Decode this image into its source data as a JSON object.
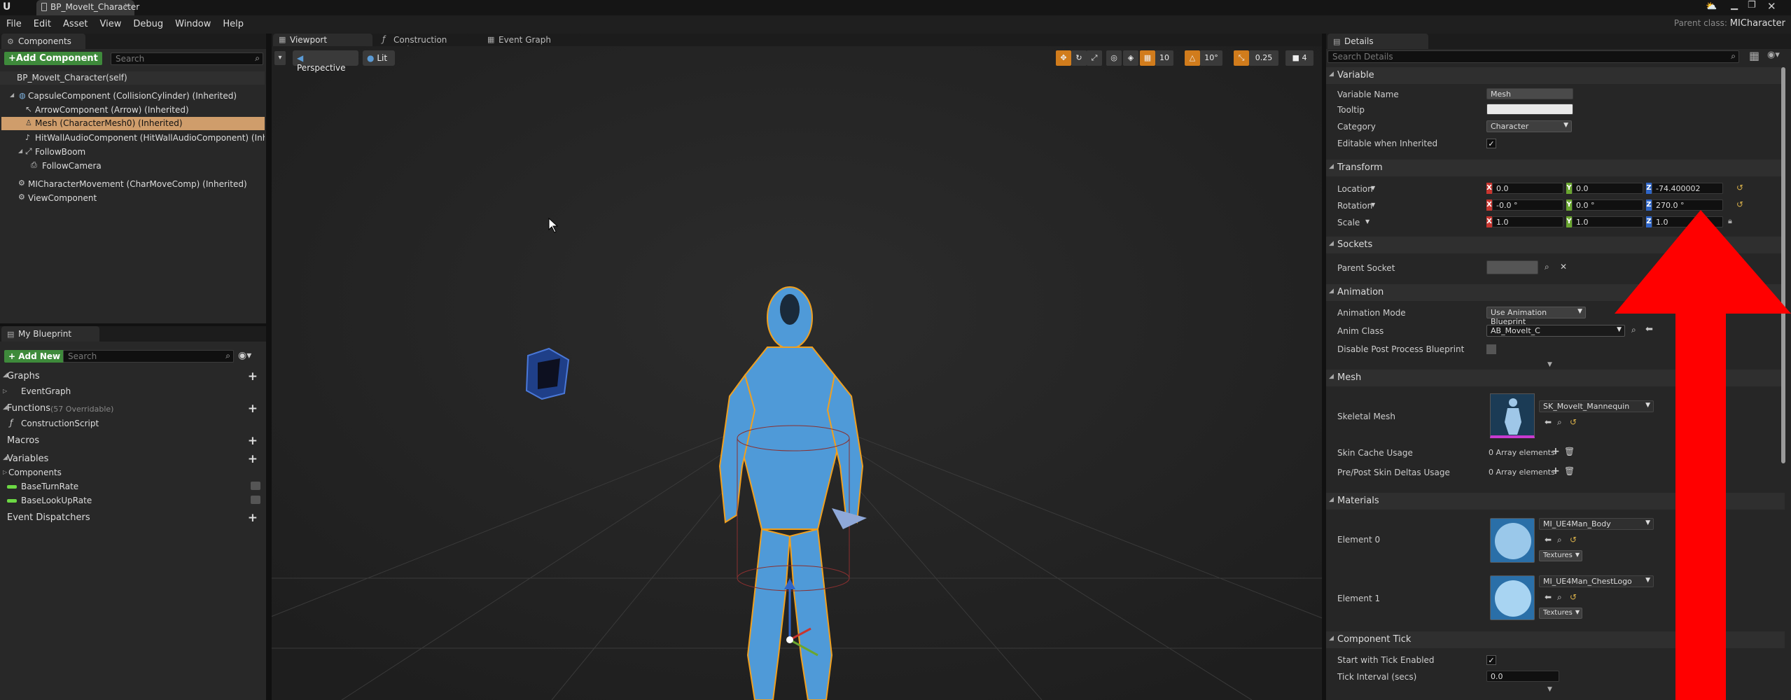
{
  "window": {
    "tab_title": "BP_MoveIt_Character",
    "parent_class_label": "Parent class:",
    "parent_class_value": "MICharacter"
  },
  "menu": [
    "File",
    "Edit",
    "Asset",
    "View",
    "Debug",
    "Window",
    "Help"
  ],
  "components": {
    "tab": "Components",
    "add_button": "+Add Component",
    "search_placeholder": "Search",
    "tree": [
      "BP_MoveIt_Character(self)",
      "CapsuleComponent (CollisionCylinder) (Inherited)",
      "ArrowComponent (Arrow) (Inherited)",
      "Mesh (CharacterMesh0) (Inherited)",
      "HitWallAudioComponent (HitWallAudioComponent) (Inherited)",
      "FollowBoom",
      "FollowCamera",
      "MICharacterMovement (CharMoveComp) (Inherited)",
      "ViewComponent"
    ]
  },
  "my_blueprint": {
    "tab": "My Blueprint",
    "add_button": "+ Add New",
    "search_placeholder": "Search",
    "graphs": "Graphs",
    "event_graph": "EventGraph",
    "functions": "Functions",
    "functions_count": "(57 Overridable)",
    "construction_script": "ConstructionScript",
    "macros": "Macros",
    "variables": "Variables",
    "components": "Components",
    "var1": "BaseTurnRate",
    "var2": "BaseLookUpRate",
    "event_dispatchers": "Event Dispatchers"
  },
  "editor_tabs": [
    "Viewport",
    "Construction Scrip",
    "Event Graph"
  ],
  "viewport": {
    "perspective": "Perspective",
    "lit": "Lit",
    "grid_snap": "10",
    "rot_snap": "10°",
    "scale_snap": "0.25",
    "cam_speed": "4"
  },
  "details": {
    "tab": "Details",
    "search_placeholder": "Search Details",
    "variable": {
      "section": "Variable",
      "name_label": "Variable Name",
      "name_value": "Mesh",
      "tooltip_label": "Tooltip",
      "category_label": "Category",
      "category_value": "Character",
      "editable_label": "Editable when Inherited"
    },
    "transform": {
      "section": "Transform",
      "location_label": "Location",
      "rotation_label": "Rotation",
      "scale_label": "Scale",
      "location": [
        "0.0",
        "0.0",
        "-74.400002"
      ],
      "rotation": [
        "-0.0 °",
        "0.0 °",
        "270.0 °"
      ],
      "scale": [
        "1.0",
        "1.0",
        "1.0"
      ]
    },
    "sockets": {
      "section": "Sockets",
      "parent_socket_label": "Parent Socket"
    },
    "animation": {
      "section": "Animation",
      "mode_label": "Animation Mode",
      "mode_value": "Use Animation Blueprint",
      "class_label": "Anim Class",
      "class_value": "AB_MoveIt_C",
      "disable_label": "Disable Post Process Blueprint"
    },
    "mesh": {
      "section": "Mesh",
      "skeletal_label": "Skeletal Mesh",
      "skeletal_value": "SK_MoveIt_Mannequin",
      "skin_cache_label": "Skin Cache Usage",
      "skin_cache_value": "0 Array elements",
      "prepost_label": "Pre/Post Skin Deltas Usage",
      "prepost_value": "0 Array elements"
    },
    "materials": {
      "section": "Materials",
      "el0_label": "Element 0",
      "el0_value": "MI_UE4Man_Body",
      "el1_label": "Element 1",
      "el1_value": "MI_UE4Man_ChestLogo",
      "textures": "Textures"
    },
    "tick": {
      "section": "Component Tick",
      "start_label": "Start with Tick Enabled",
      "interval_label": "Tick Interval (secs)",
      "interval_value": "0.0"
    }
  },
  "colors": {
    "accent_green": "#3e8a3b",
    "selection": "#cf9d6b",
    "arrow_red": "#ff0000",
    "axis_x": "#c8352f",
    "axis_y": "#6aa630",
    "axis_z": "#2f66c8",
    "mannequin": "#4f9ad8",
    "outline": "#f0a020"
  }
}
